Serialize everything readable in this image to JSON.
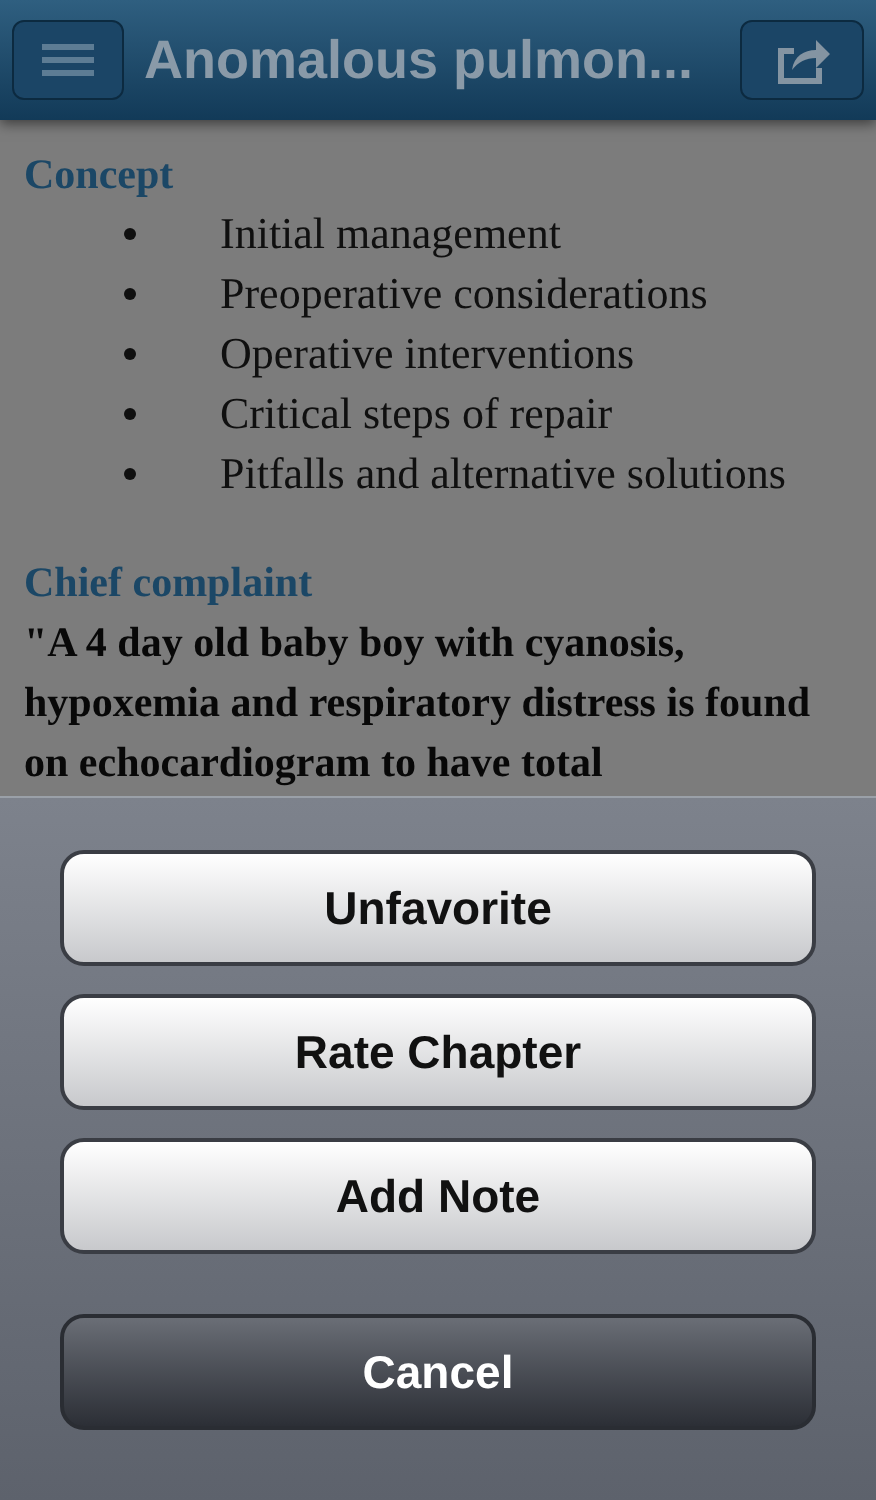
{
  "nav_bar": {
    "title": "Anomalous pulmon..."
  },
  "article": {
    "sections": [
      {
        "heading": "Concept",
        "bullets": [
          "Initial management",
          "Preoperative considerations",
          "Operative interventions",
          "Critical steps of repair",
          "Pitfalls and alternative solutions"
        ]
      },
      {
        "heading": "Chief complaint",
        "quote": "\"A 4 day old baby boy with cyanosis, hypoxemia and respiratory distress is found on echocardiogram to have total"
      }
    ]
  },
  "action_sheet": {
    "buttons": [
      {
        "label": "Unfavorite",
        "kind": "default"
      },
      {
        "label": "Rate Chapter",
        "kind": "default"
      },
      {
        "label": "Add Note",
        "kind": "default"
      },
      {
        "label": "Cancel",
        "kind": "cancel"
      }
    ]
  }
}
